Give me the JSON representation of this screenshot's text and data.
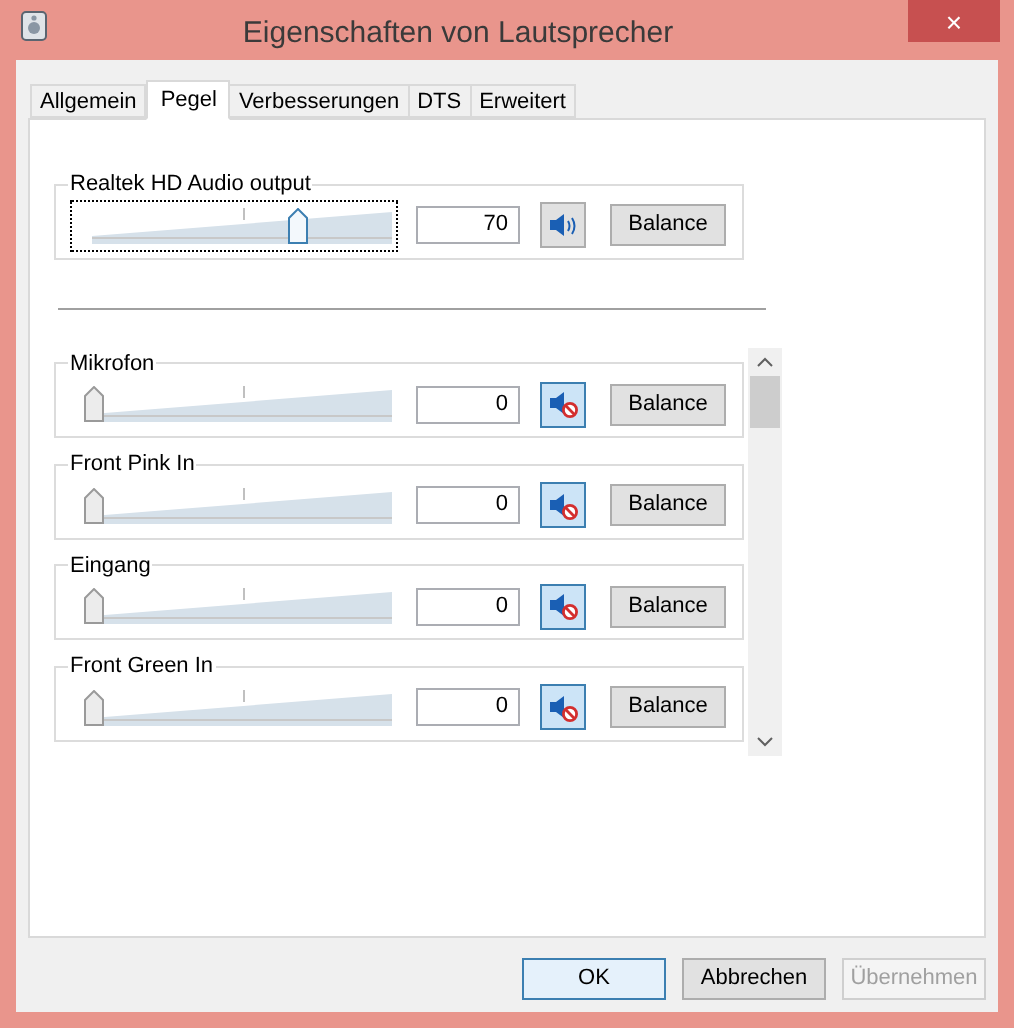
{
  "window": {
    "title": "Eigenschaften von Lautsprecher",
    "close": "×"
  },
  "tabs": [
    {
      "label": "Allgemein",
      "selected": false
    },
    {
      "label": "Pegel",
      "selected": true
    },
    {
      "label": "Verbesserungen",
      "selected": false
    },
    {
      "label": "DTS",
      "selected": false
    },
    {
      "label": "Erweitert",
      "selected": false
    }
  ],
  "master": {
    "name": "Realtek HD Audio output",
    "level": 0.7,
    "value": "70",
    "muted": false,
    "balance": "Balance",
    "focused": true
  },
  "channels": [
    {
      "name": "Mikrofon",
      "level": 0,
      "value": "0",
      "muted": true,
      "balance": "Balance"
    },
    {
      "name": "Front Pink In",
      "level": 0,
      "value": "0",
      "muted": true,
      "balance": "Balance"
    },
    {
      "name": "Eingang",
      "level": 0,
      "value": "0",
      "muted": true,
      "balance": "Balance"
    },
    {
      "name": "Front Green In",
      "level": 0,
      "value": "0",
      "muted": true,
      "balance": "Balance"
    }
  ],
  "buttons": [
    {
      "label": "OK",
      "disabled": false,
      "default": true
    },
    {
      "label": "Abbrechen",
      "disabled": false,
      "default": false
    },
    {
      "label": "Übernehmen",
      "disabled": true,
      "default": false
    }
  ]
}
